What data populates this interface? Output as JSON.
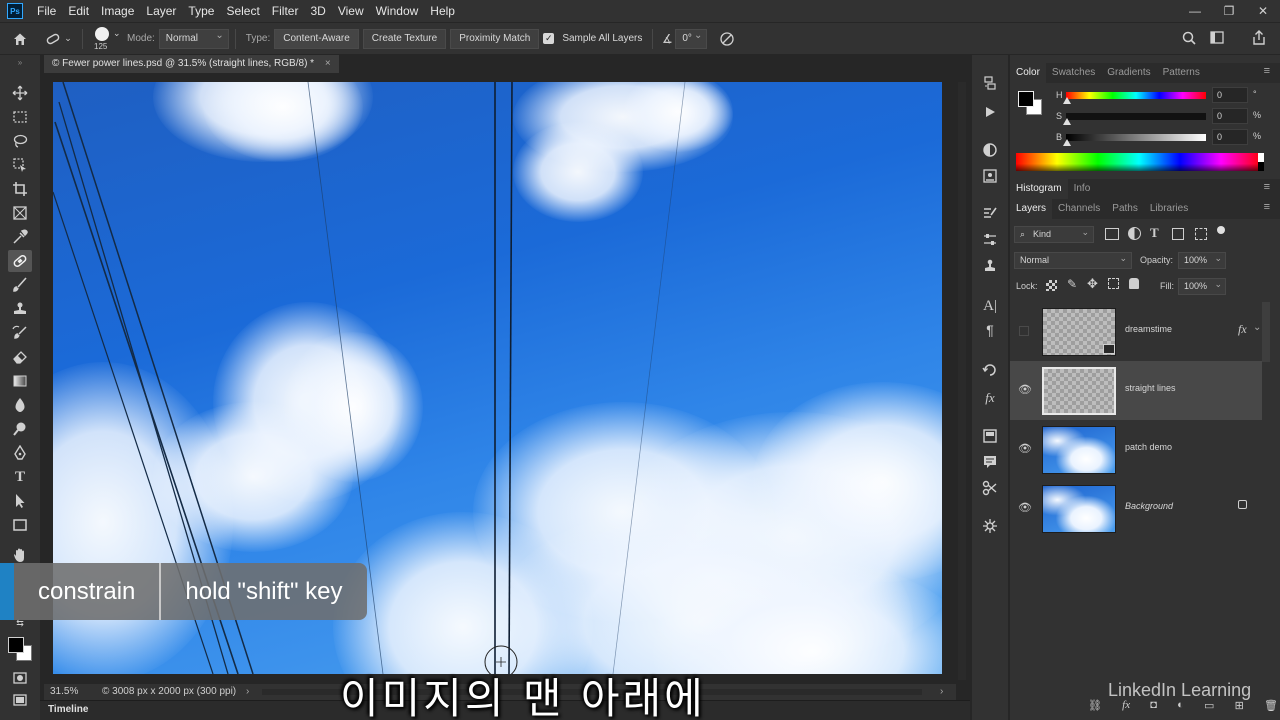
{
  "app": {
    "logo": "Ps"
  },
  "menu": [
    "File",
    "Edit",
    "Image",
    "Layer",
    "Type",
    "Select",
    "Filter",
    "3D",
    "View",
    "Window",
    "Help"
  ],
  "window_controls": [
    "—",
    "❐",
    "✕"
  ],
  "options": {
    "brush_size": "125",
    "mode_label": "Mode:",
    "mode_value": "Normal",
    "type_label": "Type:",
    "type_buttons": [
      "Content-Aware",
      "Create Texture",
      "Proximity Match"
    ],
    "sample_all_layers": "Sample All Layers",
    "angle_value": "0°"
  },
  "document": {
    "tab_title": "© Fewer power lines.psd @ 31.5% (straight lines, RGB/8) *",
    "tab_close": "×"
  },
  "status": {
    "zoom": "31.5%",
    "info": "© 3008 px x 2000 px (300 ppi)"
  },
  "timeline": {
    "label": "Timeline"
  },
  "caption": {
    "left": "constrain",
    "right": "hold \"shift\" key"
  },
  "subtitle": "이미지의 맨 아래에",
  "watermark": "LinkedIn Learning",
  "color_panel": {
    "tabs": [
      "Color",
      "Swatches",
      "Gradients",
      "Patterns"
    ],
    "sliders": [
      {
        "label": "H",
        "value": "0",
        "unit": "°"
      },
      {
        "label": "S",
        "value": "0",
        "unit": "%"
      },
      {
        "label": "B",
        "value": "0",
        "unit": "%"
      }
    ]
  },
  "histogram_tabs": [
    "Histogram",
    "Info"
  ],
  "layers_panel": {
    "tabs": [
      "Layers",
      "Channels",
      "Paths",
      "Libraries"
    ],
    "filter_kind": "Kind",
    "blend_mode": "Normal",
    "opacity_label": "Opacity:",
    "opacity_value": "100%",
    "lock_label": "Lock:",
    "fill_label": "Fill:",
    "fill_value": "100%",
    "layers": [
      {
        "name": "dreamstime",
        "visible": false,
        "selected": false,
        "thumb": "checker",
        "fx": "fx"
      },
      {
        "name": "straight lines",
        "visible": true,
        "selected": true,
        "thumb": "checker"
      },
      {
        "name": "patch demo",
        "visible": true,
        "selected": false,
        "thumb": "sky"
      },
      {
        "name": "Background",
        "visible": true,
        "selected": false,
        "thumb": "sky",
        "locked": true
      }
    ]
  },
  "colors": {
    "accent": "#1f82c4",
    "panel_bg": "#323232",
    "app_bg": "#262626",
    "selection": "#484848"
  }
}
